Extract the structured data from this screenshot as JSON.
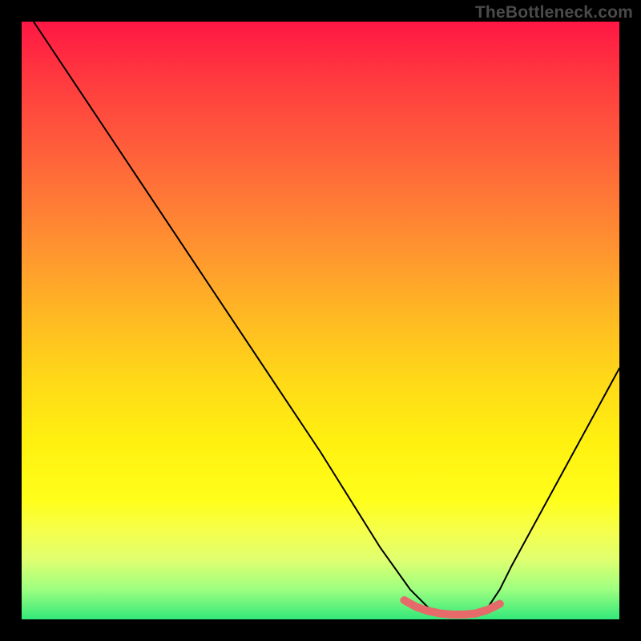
{
  "watermark": "TheBottleneck.com",
  "chart_data": {
    "type": "line",
    "title": "",
    "xlabel": "",
    "ylabel": "",
    "xlim": [
      0,
      100
    ],
    "ylim": [
      0,
      100
    ],
    "series": [
      {
        "name": "bottleneck-curve",
        "color": "#000000",
        "x": [
          2,
          10,
          20,
          30,
          40,
          50,
          60,
          65,
          68,
          70,
          72,
          74,
          76,
          78,
          80,
          82,
          100
        ],
        "y": [
          100,
          88,
          73,
          58,
          43,
          28,
          12,
          5,
          2,
          1,
          0.5,
          0.5,
          1,
          2,
          5,
          9,
          42
        ]
      },
      {
        "name": "optimal-highlight",
        "color": "#e76a6a",
        "x": [
          64,
          66,
          68,
          70,
          72,
          74,
          76,
          78,
          80
        ],
        "y": [
          3.2,
          2.1,
          1.4,
          1.0,
          0.8,
          0.8,
          1.0,
          1.6,
          2.6
        ]
      }
    ],
    "background_gradient": {
      "top": "#ff1744",
      "mid": "#ffeb3b",
      "bottom": "#33e87a"
    }
  }
}
